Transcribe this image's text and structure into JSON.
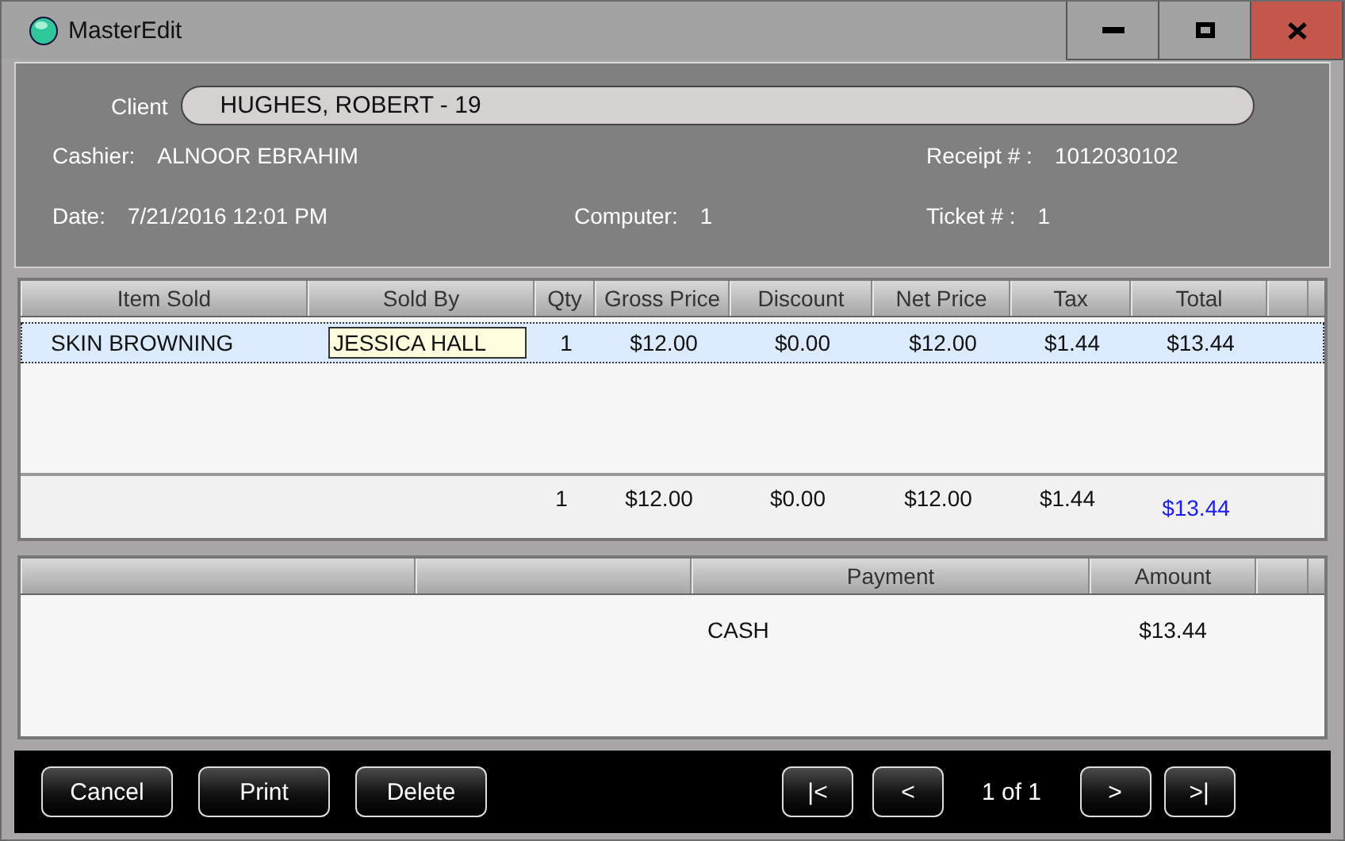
{
  "window": {
    "title": "MasterEdit"
  },
  "client": {
    "label": "Client",
    "value": "HUGHES, ROBERT - 19"
  },
  "info_rows": [
    [
      {
        "label": "Cashier:",
        "value": "ALNOOR EBRAHIM"
      },
      null,
      {
        "label": "Receipt # :",
        "value": "1012030102"
      }
    ],
    [
      {
        "label": "Date:",
        "value": "7/21/2016 12:01 PM"
      },
      {
        "label": "Computer:",
        "value": "1"
      },
      {
        "label": "Ticket # :",
        "value": "1"
      }
    ]
  ],
  "items": {
    "columns": [
      "Item Sold",
      "Sold By",
      "Qty",
      "Gross Price",
      "Discount",
      "Net Price",
      "Tax",
      "Total"
    ],
    "rows": [
      {
        "selected": true,
        "cells": [
          {
            "text": "SKIN BROWNING",
            "editing": false
          },
          {
            "text": "JESSICA HALL",
            "editing": true
          },
          {
            "text": "1",
            "editing": false
          },
          {
            "text": "$12.00",
            "editing": false
          },
          {
            "text": "$0.00",
            "editing": false
          },
          {
            "text": "$12.00",
            "editing": false
          },
          {
            "text": "$1.44",
            "editing": false
          },
          {
            "text": "$13.44",
            "editing": false
          }
        ]
      }
    ],
    "totals": [
      {
        "text": "1",
        "highlighted": false
      },
      {
        "text": "$12.00",
        "highlighted": false
      },
      {
        "text": "$0.00",
        "highlighted": false
      },
      {
        "text": "$12.00",
        "highlighted": false
      },
      {
        "text": "$1.44",
        "highlighted": false
      },
      {
        "text": "$13.44",
        "highlighted": true
      }
    ]
  },
  "payments": {
    "columns": [
      "Payment",
      "Amount"
    ],
    "rows": [
      {
        "payment": "CASH",
        "amount": "$13.44"
      }
    ]
  },
  "buttons": [
    "Cancel",
    "Print",
    "Delete"
  ],
  "pager": {
    "first": "|<",
    "previous": "<",
    "page": "1 of 1",
    "next": ">",
    "last": ">|"
  }
}
